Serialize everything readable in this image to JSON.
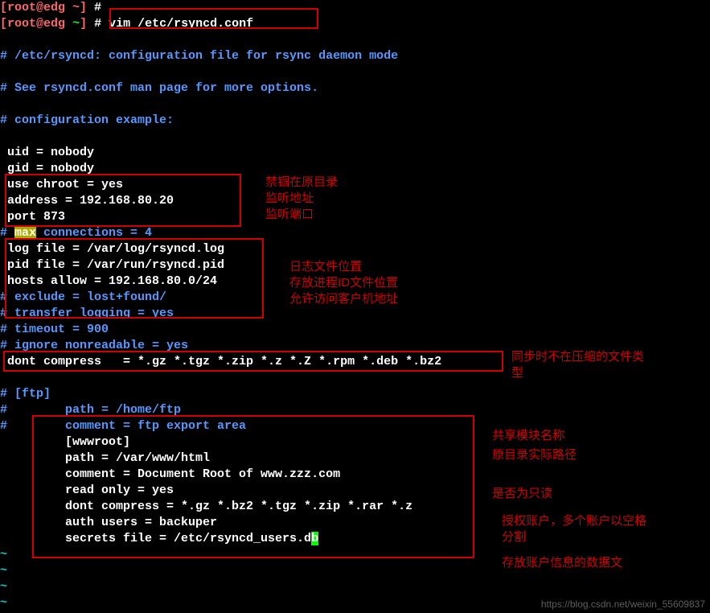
{
  "prompt": {
    "lbracket": "[",
    "user": "root",
    "at": "@",
    "host": "edg",
    "dir": " ~",
    "rbracket": "]",
    "hash": " # ",
    "cmd": "vim /etc/rsyncd.conf"
  },
  "lines": {
    "c1": "# /etc/rsyncd: configuration file for rsync daemon mode",
    "c2": "# See rsyncd.conf man page for more options.",
    "c3": "# configuration example:",
    "uid": " uid = nobody",
    "gid": " gid = nobody",
    "chroot": " use chroot = yes",
    "addr": " address = 192.168.80.20",
    "port": " port 873",
    "max_pre": "# ",
    "max_hi": "max",
    "max_post": " connections = 4",
    "log": " log file = /var/log/rsyncd.log",
    "pid": " pid file = /var/run/rsyncd.pid",
    "hosts": " hosts allow = 192.168.80.0/24",
    "excl": "# exclude = lost+found/",
    "tlog": "# transfer logging = yes",
    "to": "# timeout = 900",
    "ign": "# ignore nonreadable = yes",
    "dc": " dont compress   = *.gz *.tgz *.zip *.z *.Z *.rpm *.deb *.bz2",
    "ftp": "# [ftp]",
    "path": "#        path = /home/ftp",
    "cmt": "#        comment = ftp export area",
    "mod": "         [wwwroot]",
    "mpath": "         path = /var/www/html",
    "mcmt": "         comment = Document Root of www.zzz.com",
    "ro": "         read only = yes",
    "mdc": "         dont compress = *.gz *.bz2 *.tgz *.zip *.rar *.z",
    "auth": "         auth users = backuper",
    "sec": "         secrets file = /etc/rsyncd_users.d",
    "sec_cur": "b",
    "tilde": "~"
  },
  "annot": {
    "chroot": "禁锢在原目录",
    "addr": "监听地址",
    "port": "监听端口",
    "log": "日志文件位置",
    "pid": "存放进程ID文件位置",
    "hosts": "允许访问客户机地址",
    "dc1": "同步时不在压缩的文件类",
    "dc2": "型",
    "mod": "共享模块名称",
    "path": "原目录实际路径",
    "ro": "是否为只读",
    "auth1": "授权账户，多个账户以空格",
    "auth2": "分割",
    "sec": "存放账户信息的数据文"
  },
  "watermark": "https://blog.csdn.net/weixin_55609837"
}
